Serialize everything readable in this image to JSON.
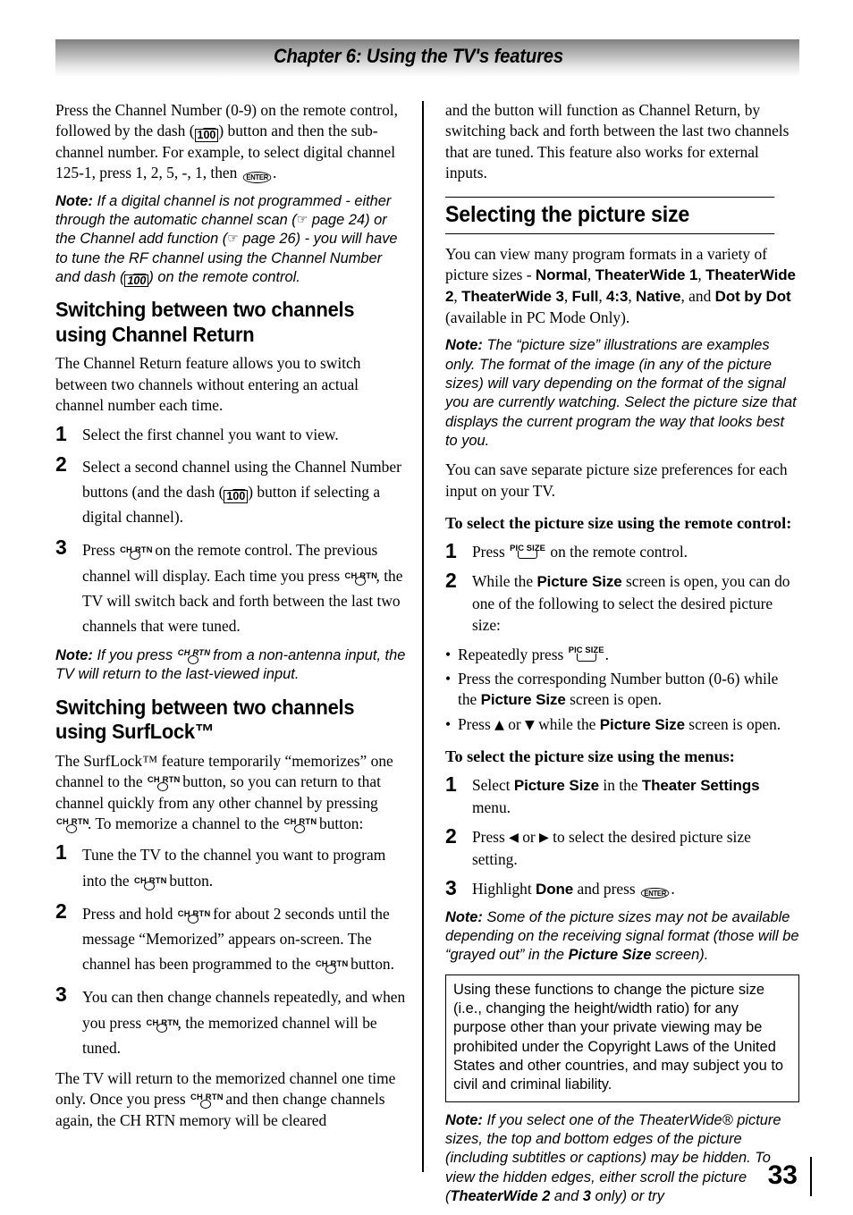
{
  "header": {
    "chapter_title": "Chapter 6: Using the TV's features"
  },
  "icons": {
    "dash_100": "100",
    "enter": "ENTER",
    "ch_rtn": "CH RTN",
    "pic_size": "PIC SIZE",
    "hand_pointer": "☞",
    "arrow_up": "▲",
    "arrow_down": "▼",
    "arrow_left": "◀",
    "arrow_right": "▶"
  },
  "left_column": {
    "intro_paragraph": {
      "part1": "Press the Channel Number (0-9) on the remote control, followed by the dash (",
      "part2": ") button and then the sub-channel number. For example, to select digital channel 125-1, press 1, 2, 5, -, 1, then ",
      "part3": "."
    },
    "note_digital_channel": {
      "label": "Note:",
      "part1": " If a digital channel is not programmed - either through the automatic channel scan (",
      "part2": " page 24) or the Channel add function (",
      "part3": " page 26) - you will have to tune the RF channel using the Channel Number and dash (",
      "part4": ") on the remote control."
    },
    "heading_channel_return": "Switching between two channels using Channel Return",
    "channel_return_intro": "The Channel Return feature allows you to switch between two channels without entering an actual channel number each time.",
    "channel_return_steps": [
      {
        "num": "1",
        "text": "Select the first channel you want to view."
      },
      {
        "num": "2",
        "part1": "Select a second channel using the Channel Number buttons (and the dash (",
        "part2": ") button if selecting a digital channel)."
      },
      {
        "num": "3",
        "part1": "Press ",
        "part2": " on the remote control. The previous channel will display. Each time you press ",
        "part3": ", the TV will switch back and forth between the last two channels that were tuned."
      }
    ],
    "note_non_antenna": {
      "label": "Note:",
      "part1": " If you press ",
      "part2": " from a non-antenna input, the TV will return to the last-viewed input."
    },
    "heading_surflock": "Switching between two channels using SurfLock™",
    "surflock_intro": {
      "part1": "The SurfLock™ feature temporarily “memorizes” one channel to the ",
      "part2": " button, so you can return to that channel quickly from any other channel by pressing ",
      "part3": ". To memorize a channel to the ",
      "part4": " button:"
    },
    "surflock_steps": [
      {
        "num": "1",
        "part1": "Tune the TV to the channel you want to program into the ",
        "part2": " button."
      },
      {
        "num": "2",
        "part1": "Press and hold ",
        "part2": " for about 2 seconds until the message “Memorized” appears on-screen. The channel has been programmed to the ",
        "part3": " button."
      },
      {
        "num": "3",
        "part1": "You can then change channels repeatedly, and when you press ",
        "part2": ", the memorized channel will be tuned."
      }
    ],
    "surflock_outro": {
      "part1": "The TV will return to the memorized channel one time only. Once you press ",
      "part2": " and then change channels again, the CH RTN memory will be cleared"
    }
  },
  "right_column": {
    "continuation_paragraph": "and the button will function as Channel Return, by switching back and forth between the last two channels that are tuned. This feature also works for external inputs.",
    "heading_picture_size": "Selecting the picture size",
    "picture_sizes_intro": {
      "lead": "You can view many program formats in a variety of picture sizes - ",
      "sizes": [
        "Normal",
        "TheaterWide 1",
        "TheaterWide 2",
        "TheaterWide 3",
        "Full",
        "4:3",
        "Native",
        "Dot by Dot"
      ],
      "and_word": "and ",
      "trail": " (available in PC Mode Only)."
    },
    "note_illustrations": {
      "label": "Note:",
      "text": " The “picture size” illustrations are examples only. The format of the image (in any of the picture sizes) will vary depending on the format of the signal you are currently watching. Select the picture size that displays the current program the way that looks best to you."
    },
    "save_preferences": "You can save separate picture size preferences for each input on your TV.",
    "subhead_remote": "To select the picture size using the remote control:",
    "remote_steps": [
      {
        "num": "1",
        "part1": "Press ",
        "part2": " on the remote control."
      },
      {
        "num": "2",
        "part1": "While the ",
        "bold1": "Picture Size",
        "part2": " screen is open, you can do one of the following to select the desired picture size:"
      }
    ],
    "remote_bullets": [
      {
        "part1": "Repeatedly press ",
        "part2": "."
      },
      {
        "part1": "Press the corresponding Number button (0-6) while the ",
        "bold1": "Picture Size",
        "part2": " screen is open."
      },
      {
        "part1": "Press ",
        "part2": " or ",
        "part3": " while the ",
        "bold1": "Picture Size",
        "part4": " screen is open."
      }
    ],
    "subhead_menus": "To select the picture size using the menus:",
    "menu_steps": [
      {
        "num": "1",
        "part1": "Select ",
        "bold1": "Picture Size",
        "part2": " in the ",
        "bold2": "Theater Settings",
        "part3": " menu."
      },
      {
        "num": "2",
        "part1": "Press ",
        "part2": " or ",
        "part3": " to select the desired picture size setting."
      },
      {
        "num": "3",
        "part1": "Highlight ",
        "bold1": "Done",
        "part2": " and press ",
        "part3": "."
      }
    ],
    "note_grayed_out": {
      "label": "Note:",
      "part1": " Some of the picture sizes may not be available depending on the receiving signal format (those will be “grayed out” in the ",
      "bold1": "Picture Size",
      "part2": " screen)."
    },
    "copyright_box": "Using these functions to change the picture size (i.e., changing the height/width ratio) for any purpose other than your private viewing may be prohibited under the Copyright Laws of the United States and other countries, and may subject you to civil and criminal liability.",
    "note_theaterwide": {
      "label": "Note:",
      "part1": " If you select one of the TheaterWide® picture sizes, the top and bottom edges of the picture (including subtitles or captions) may be hidden. To view the hidden edges, either scroll the picture (",
      "bold1": "TheaterWide 2",
      "part2": " and ",
      "bold2": "3",
      "part3": " only) or try"
    }
  },
  "footer": {
    "page_number": "33"
  }
}
